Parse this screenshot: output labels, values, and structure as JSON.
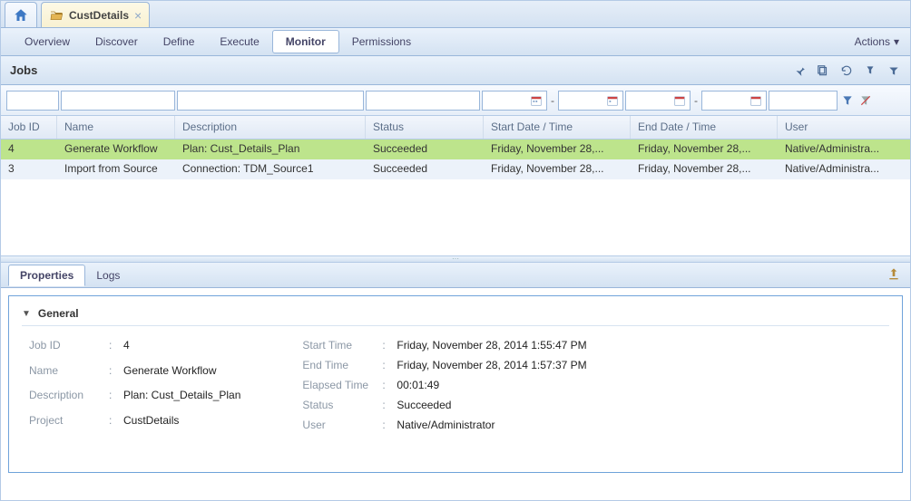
{
  "tabs": {
    "main": {
      "label": "CustDetails"
    },
    "secondary": [
      "Overview",
      "Discover",
      "Define",
      "Execute",
      "Monitor",
      "Permissions"
    ],
    "active_secondary": "Monitor",
    "actions_label": "Actions"
  },
  "jobs_panel": {
    "title": "Jobs",
    "columns": [
      "Job ID",
      "Name",
      "Description",
      "Status",
      "Start Date / Time",
      "End Date / Time",
      "User"
    ],
    "rows": [
      {
        "id": "4",
        "name": "Generate Workflow",
        "description": "Plan: Cust_Details_Plan",
        "status": "Succeeded",
        "start": "Friday, November 28,...",
        "end": "Friday, November 28,...",
        "user": "Native/Administra..."
      },
      {
        "id": "3",
        "name": "Import from Source",
        "description": "Connection: TDM_Source1",
        "status": "Succeeded",
        "start": "Friday, November 28,...",
        "end": "Friday, November 28,...",
        "user": "Native/Administra..."
      }
    ]
  },
  "lower_tabs": {
    "items": [
      "Properties",
      "Logs"
    ],
    "active": "Properties"
  },
  "general_section": {
    "title": "General",
    "left": [
      {
        "label": "Job ID",
        "value": "4"
      },
      {
        "label": "Name",
        "value": "Generate Workflow"
      },
      {
        "label": "Description",
        "value": "Plan: Cust_Details_Plan"
      },
      {
        "label": "Project",
        "value": "CustDetails"
      }
    ],
    "right": [
      {
        "label": "Start Time",
        "value": "Friday, November 28, 2014 1:55:47 PM"
      },
      {
        "label": "End Time",
        "value": "Friday, November 28, 2014 1:57:37 PM"
      },
      {
        "label": "Elapsed Time",
        "value": "00:01:49"
      },
      {
        "label": "Status",
        "value": "Succeeded"
      },
      {
        "label": "User",
        "value": "Native/Administrator"
      }
    ]
  }
}
